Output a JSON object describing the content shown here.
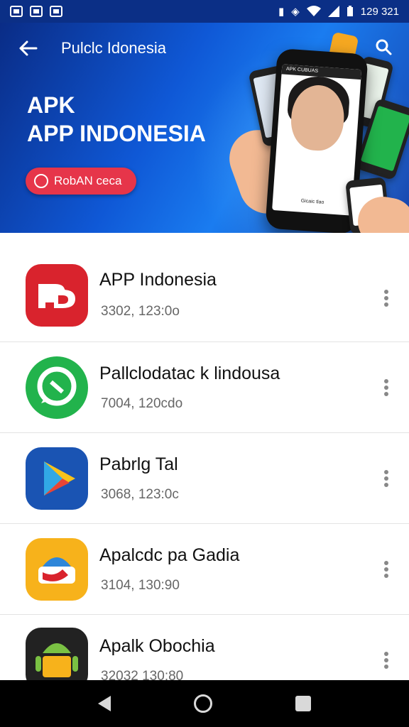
{
  "status_bar": {
    "time": "129 321"
  },
  "header": {
    "title": "Pulclc Idonesia"
  },
  "hero": {
    "line1": "APK",
    "line2": "APP INDONESIA",
    "button_label": "RobAN ceca",
    "phone_label_top": "APK CUBUAS",
    "phone_label_bottom": "Gicaic tlao"
  },
  "apps": [
    {
      "name": "APP Indonesia",
      "meta": "3302, 123:0o",
      "icon": "red-pd-icon",
      "color": "#d9232d"
    },
    {
      "name": "Pallclodatac k lindousa",
      "meta": "7004, 120cdo",
      "icon": "green-chat-icon",
      "color": "#22b34c"
    },
    {
      "name": "Pabrlg Tal",
      "meta": "3068, 123:0c",
      "icon": "play-store-icon",
      "color": "#1a54b3"
    },
    {
      "name": "Apalcdc pa Gadia",
      "meta": "3104, 130:90",
      "icon": "android-orange-icon",
      "color": "#f7b21b"
    },
    {
      "name": "Apalk Obochia",
      "meta": "32032 130:80",
      "icon": "android-green-icon",
      "color": "#222222"
    }
  ]
}
